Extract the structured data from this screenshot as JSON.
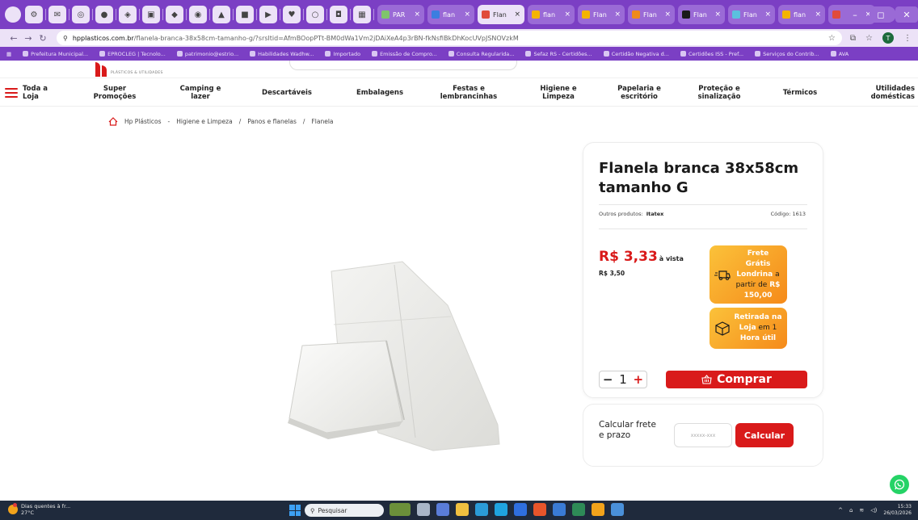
{
  "browser": {
    "tabs": [
      {
        "label": "PAR",
        "color": "#7fc46b"
      },
      {
        "label": "flan",
        "color": "#3b7ee0"
      },
      {
        "label": "Flan",
        "color": "#e04b3b"
      },
      {
        "label": "flan",
        "color": "#f4b400"
      },
      {
        "label": "Flan",
        "color": "#f4b400"
      },
      {
        "label": "Flan",
        "color": "#f08a1a"
      },
      {
        "label": "Flan",
        "color": "#1a1a1a"
      },
      {
        "label": "Flan",
        "color": "#5bc0de"
      },
      {
        "label": "flan",
        "color": "#f4b400"
      },
      {
        "label": "Pan",
        "color": "#e04b3b"
      }
    ],
    "url_domain": "hpplasticos.com.br",
    "url_path": "/flanela-branca-38x58cm-tamanho-g/?srsltid=AfmBOopPTt-BM0dWa1Vm2jDAiXeA4p3rBN-fkNsfiBkDhKocUVpJSNOVzkM",
    "bookmarks": [
      "Prefeitura Municipal...",
      "EPROCLEG | Tecnolo...",
      "patrimonio@estrio...",
      "Habilidades Wadhw...",
      "Importado",
      "Emissão de Compro...",
      "Consulta Regularida...",
      "Sefaz RS - Certidões...",
      "Certidão Negativa d...",
      "Certidões ISS - Pref...",
      "Serviços do Contrib...",
      "AVA"
    ]
  },
  "site": {
    "logo_subtitle": "PLÁSTICOS & UTILIDADES",
    "categories": {
      "all": "Toda a\nLoja",
      "items": [
        "Super\nPromoções",
        "Camping e\nlazer",
        "Descartáveis",
        "Embalagens",
        "Festas e\nlembrancinhas",
        "Higiene e\nLimpeza",
        "Papelaria e\nescritório",
        "Proteção e\nsinalização",
        "Térmicos",
        "Utilidades\ndomésticas"
      ]
    },
    "breadcrumb": [
      "Hp Plásticos",
      "-",
      "Higiene e Limpeza",
      "/",
      "Panos e flanelas",
      "/",
      "Flanela"
    ]
  },
  "product": {
    "title": "Flanela branca 38x58cm tamanho G",
    "other_label": "Outros produtos:",
    "brand": "Itatex",
    "code": "Código: 1613",
    "price": "R$ 3,33",
    "price_suffix": "à vista",
    "old_price": "R$ 3,50",
    "promo_free_shipping": {
      "line1": "Frete Grátis",
      "line2": "Londrina",
      "line3": "a",
      "line4": "partir de",
      "line5": "R$",
      "line6": "150,00"
    },
    "promo_pickup": {
      "line1": "Retirada na",
      "line2": "Loja",
      "line3": "em 1",
      "line4": "Hora útil"
    },
    "quantity": "1",
    "buy_label": "Comprar",
    "shipping_label": "Calcular frete\ne prazo",
    "cep_placeholder": "xxxxx-xxx",
    "calc_label": "Calcular",
    "colors": {
      "brand_red": "#d91a1a",
      "promo_orange": "#f58a1a"
    }
  },
  "taskbar": {
    "weather_line1": "Dias quentes à fr...",
    "weather_line2": "27°C",
    "search_placeholder": "Pesquisar",
    "time": "15:33",
    "date": "26/03/2026"
  }
}
